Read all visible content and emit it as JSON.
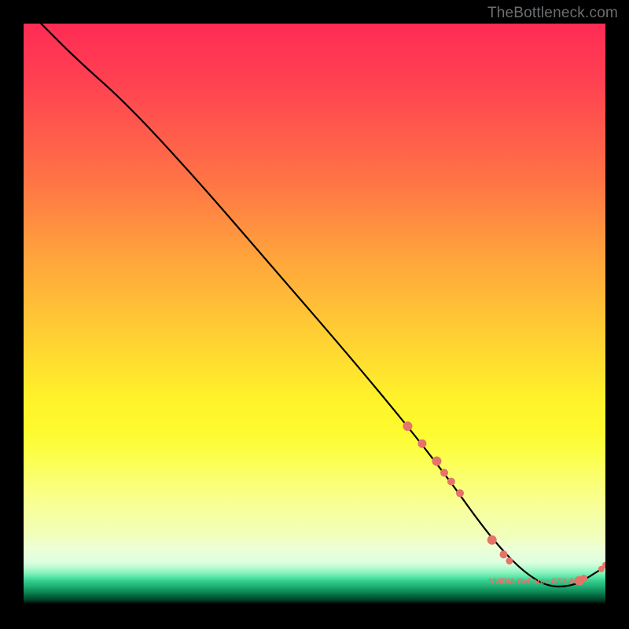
{
  "watermark": "TheBottleneck.com",
  "chart_data": {
    "type": "line",
    "title": "",
    "xlabel": "",
    "ylabel": "",
    "xlim": [
      0,
      100
    ],
    "ylim": [
      0,
      100
    ],
    "grid": false,
    "series": [
      {
        "name": "bottleneck-curve",
        "x": [
          3,
          9,
          18,
          30,
          43,
          56,
          66,
          73,
          78,
          82,
          86,
          90,
          94,
          97,
          100
        ],
        "y": [
          100,
          94,
          86,
          73,
          58,
          43,
          31,
          22,
          15,
          10,
          6,
          3.5,
          3.5,
          5,
          7
        ],
        "color": "#000000"
      }
    ],
    "markers": [
      {
        "x": 66,
        "y": 31,
        "r": 6,
        "color": "#e57368"
      },
      {
        "x": 68.5,
        "y": 28,
        "r": 5.5,
        "color": "#e57368"
      },
      {
        "x": 71,
        "y": 25,
        "r": 6,
        "color": "#e57368"
      },
      {
        "x": 72.3,
        "y": 23,
        "r": 5,
        "color": "#e57368"
      },
      {
        "x": 73.5,
        "y": 21.5,
        "r": 5,
        "color": "#e57368"
      },
      {
        "x": 75,
        "y": 19.5,
        "r": 5,
        "color": "#e57368"
      },
      {
        "x": 80.5,
        "y": 11.5,
        "r": 6,
        "color": "#e57368"
      },
      {
        "x": 82.5,
        "y": 9,
        "r": 5,
        "color": "#e57368"
      },
      {
        "x": 83.5,
        "y": 7.9,
        "r": 4.5,
        "color": "#e57368"
      },
      {
        "x": 95.5,
        "y": 4.5,
        "r": 6,
        "color": "#e57368"
      },
      {
        "x": 96.3,
        "y": 4.9,
        "r": 4.5,
        "color": "#e57368"
      },
      {
        "x": 99.3,
        "y": 6.5,
        "r": 4,
        "color": "#e57368"
      },
      {
        "x": 100,
        "y": 7.2,
        "r": 4,
        "color": "#e57368"
      }
    ],
    "bottom_label": {
      "text": "NVIDIA GeForce GTX 860",
      "x": 88,
      "y": 4,
      "color": "#e57368"
    }
  }
}
